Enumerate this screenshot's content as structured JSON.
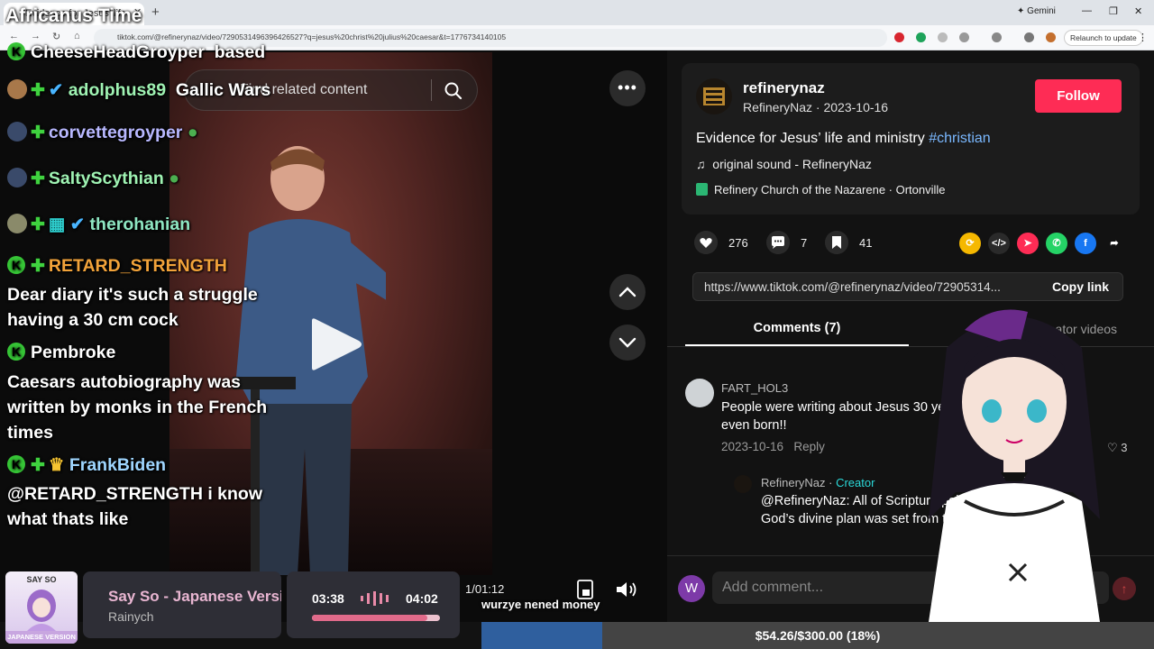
{
  "stream": {
    "title": "Africanus Time"
  },
  "browser": {
    "tab_title": "Evidence for Jesus’ life and ministry",
    "gemini_label": "Gemini",
    "url": "tiktok.com/@refinerynaz/video/7290531496396426527?q=jesus%20christ%20julius%20caesar&t=1776734140105",
    "relaunch_label": "Relaunch to update"
  },
  "video": {
    "search_placeholder": "Find related content",
    "time_code": "1/01:12"
  },
  "chat": [
    {
      "user": "CheeseHeadGroyper",
      "message": "based",
      "color": "#ffffff"
    },
    {
      "user": "adolphus89",
      "message": "Gallic Wars",
      "color": "#9ff3b3"
    },
    {
      "user": "corvettegroyper",
      "message": "",
      "color": "#b8b8ff"
    },
    {
      "user": "SaltyScythian",
      "message": "",
      "color": "#9ff3b3"
    },
    {
      "user": "therohanian",
      "message": "",
      "color": "#8ee6c2"
    },
    {
      "user": "RETARD_STRENGTH",
      "message": "Dear diary it's such a struggle having a 30 cm cock",
      "color": "#f2a33a"
    },
    {
      "user": "Pembroke",
      "message": "Caesars autobiography was written by monks in the French times",
      "color": "#ffffff"
    },
    {
      "user": "FrankBiden",
      "message": "@RETARD_STRENGTH i know what thats like",
      "color": "#9fd6ff"
    }
  ],
  "chat_badge_letter": "K",
  "post": {
    "username": "refinerynaz",
    "display_name": "RefineryNaz",
    "date": "2023-10-16",
    "follow_label": "Follow",
    "description": "Evidence for Jesus’ life and ministry ",
    "hashtag": "#christian",
    "sound": "original sound - RefineryNaz",
    "location": "Refinery Church of the Nazarene · Ortonville",
    "likes": "276",
    "comments": "7",
    "saves": "41",
    "share_url": "https://www.tiktok.com/@refinerynaz/video/72905314...",
    "copy_link_label": "Copy link",
    "tab_comments": "Comments (7)",
    "tab_videos": "Creator videos"
  },
  "comments": [
    {
      "user": "FART_HOL3",
      "text": "People were writing about Jesus 30 years before Caesar was even born!!",
      "date": "2023-10-16",
      "reply_label": "Reply",
      "likes": "3"
    }
  ],
  "reply": {
    "user": "RefineryNaz",
    "creator_label": "Creator",
    "text": "@RefineryNaz: All of Scripture points to Jesus coming. God’s divine plan was set from the very beginning :)"
  },
  "composer": {
    "avatar_letter": "W",
    "placeholder": "Add comment..."
  },
  "music": {
    "album_title": "SAY SO",
    "album_footer": "JAPANESE VERSION",
    "song": "Say So - Japanese Version",
    "artist": "Rainych",
    "current": "03:38",
    "total": "04:02",
    "progress": 0.9
  },
  "donation": {
    "donor_message": "wurzye nened money",
    "goal_text": "$54.26/$300.00 (18%)",
    "progress": 0.18
  },
  "colors": {
    "follow": "#fe2c55",
    "hashtag": "#7ab8ff",
    "creator": "#2bd9d9",
    "chat_badge": "#36c536"
  }
}
